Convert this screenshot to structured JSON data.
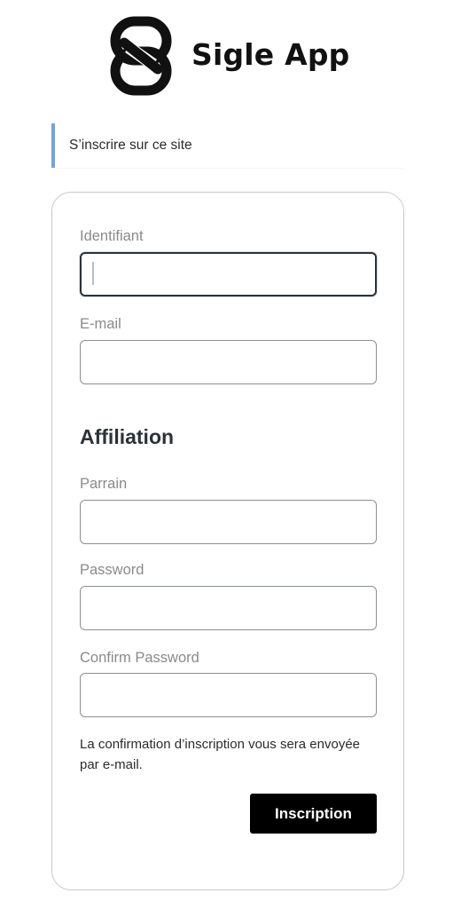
{
  "brand": {
    "name": "Sigle App",
    "logo_icon": "sigle-s-logo-icon"
  },
  "notice": {
    "text": "S’inscrire sur ce site",
    "accent_color": "#7ba1d6"
  },
  "form": {
    "fields": {
      "username": {
        "label": "Identifiant",
        "value": ""
      },
      "email": {
        "label": "E-mail",
        "value": ""
      },
      "sponsor": {
        "label": "Parrain",
        "value": ""
      },
      "password": {
        "label": "Password",
        "value": ""
      },
      "confirm_password": {
        "label": "Confirm Password",
        "value": ""
      }
    },
    "section_heading": "Affiliation",
    "help_text": "La confirmation d’inscription vous sera envoyée par e-mail.",
    "submit_label": "Inscription",
    "submit_color": "#000000"
  }
}
